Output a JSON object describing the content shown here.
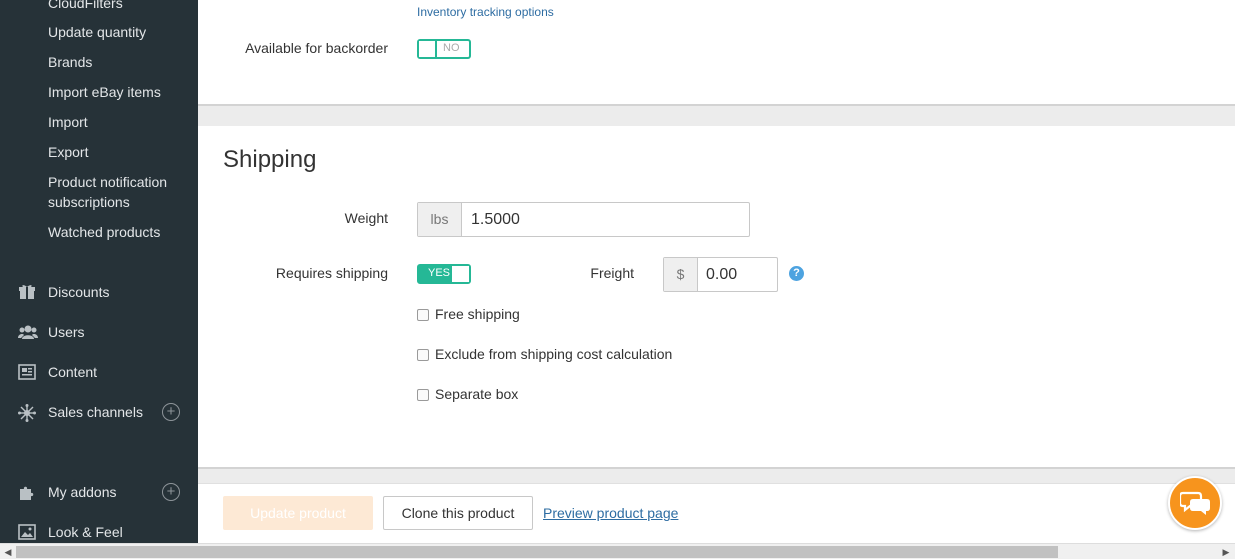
{
  "sidebar": {
    "sub_items": [
      {
        "label": "CloudFilters"
      },
      {
        "label": "Update quantity"
      },
      {
        "label": "Brands"
      },
      {
        "label": "Import eBay items"
      },
      {
        "label": "Import"
      },
      {
        "label": "Export"
      },
      {
        "label": "Product notification subscriptions"
      },
      {
        "label": "Watched products"
      }
    ],
    "main_items": [
      {
        "label": "Discounts",
        "icon": "gift-icon"
      },
      {
        "label": "Users",
        "icon": "users-icon"
      },
      {
        "label": "Content",
        "icon": "newspaper-icon"
      },
      {
        "label": "Sales channels",
        "icon": "network-icon",
        "expand": "+"
      },
      {
        "label": "My addons",
        "icon": "puzzle-icon",
        "expand": "+"
      },
      {
        "label": "Look & Feel",
        "icon": "image-icon"
      }
    ]
  },
  "inventory": {
    "tracking_link": "Inventory tracking options",
    "backorder_label": "Available for backorder",
    "backorder_toggle": "NO"
  },
  "shipping": {
    "title": "Shipping",
    "weight_label": "Weight",
    "weight_unit": "lbs",
    "weight_value": "1.5000",
    "requires_label": "Requires shipping",
    "requires_toggle": "YES",
    "freight_label": "Freight",
    "freight_currency": "$",
    "freight_value": "0.00",
    "help_glyph": "?",
    "options": [
      {
        "label": "Free shipping",
        "checked": false
      },
      {
        "label": "Exclude from shipping cost calculation",
        "checked": false
      },
      {
        "label": "Separate box",
        "checked": false
      }
    ]
  },
  "footer": {
    "update_button": "Update product",
    "clone_button": "Clone this product",
    "preview_link": "Preview product page"
  },
  "colors": {
    "sidebar_bg": "#263238",
    "accent_green": "#25b896",
    "link_blue": "#2d6ca2",
    "chat_orange": "#f7941d"
  }
}
